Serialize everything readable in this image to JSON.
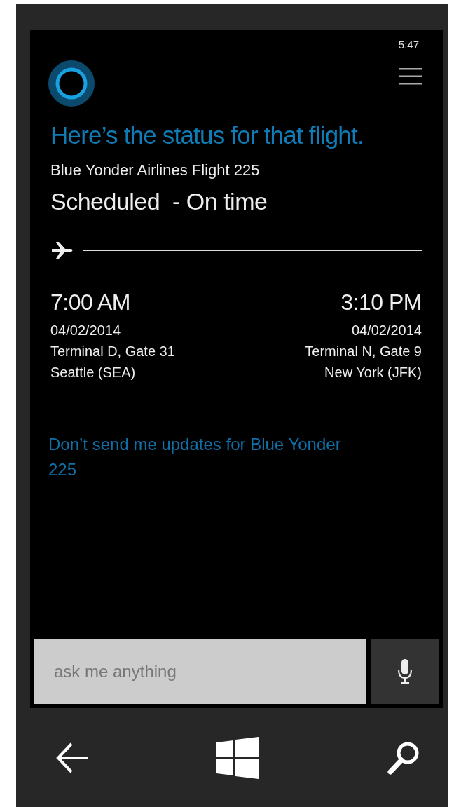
{
  "status_bar": {
    "time": "5:47"
  },
  "heading": "Here’s the status for that flight.",
  "flight": {
    "name": "Blue Yonder Airlines Flight 225",
    "status": "Scheduled  - On time"
  },
  "departure": {
    "time": "7:00 AM",
    "date": "04/02/2014",
    "terminal": "Terminal D, Gate 31",
    "city": "Seattle (SEA)"
  },
  "arrival": {
    "time": "3:10 PM",
    "date": "04/02/2014",
    "terminal": "Terminal N, Gate 9",
    "city": "New York (JFK)"
  },
  "link": "Don’t send me updates for Blue Yonder 225",
  "search": {
    "placeholder": "ask me anything"
  }
}
